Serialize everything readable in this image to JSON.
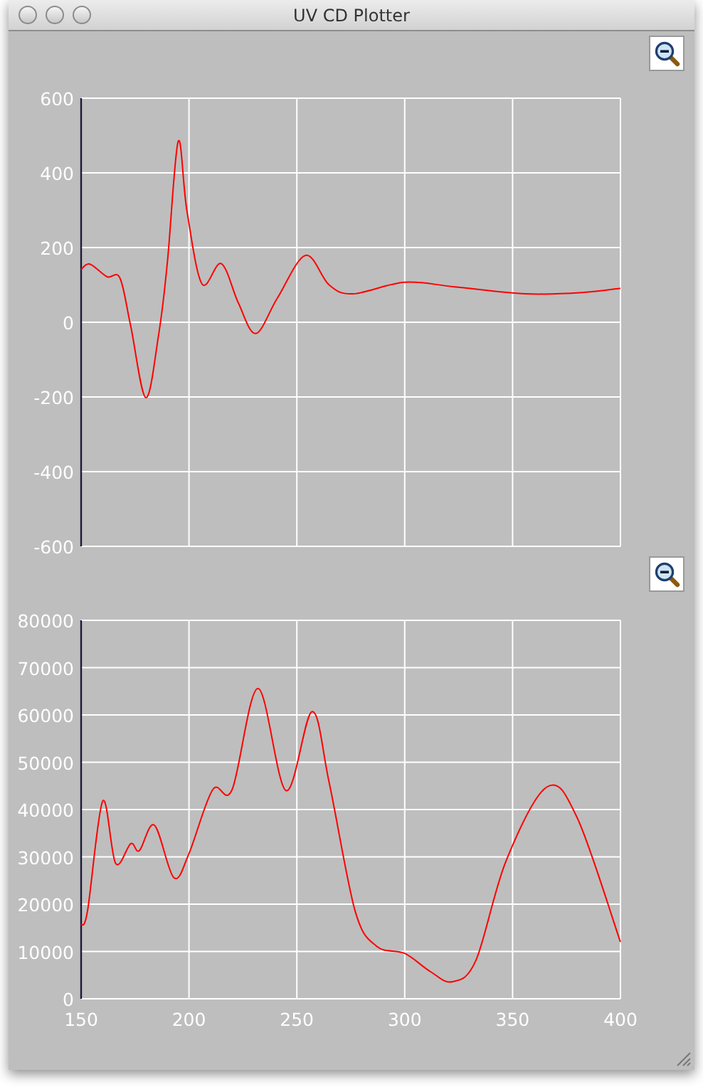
{
  "window": {
    "title": "UV CD Plotter"
  },
  "plots": [
    {
      "zoom_button": {
        "kind": "zoom-out"
      },
      "chart_data": {
        "type": "line",
        "grid": true,
        "xlim": [
          150,
          400
        ],
        "ylim": [
          -600,
          600
        ],
        "yticks": [
          -600,
          -400,
          -200,
          0,
          200,
          400,
          600
        ],
        "x": [
          150,
          154,
          162,
          168,
          173,
          180,
          186,
          190,
          195,
          199,
          206,
          215,
          223,
          231,
          241,
          254,
          265,
          276,
          300,
          323,
          356,
          383,
          400
        ],
        "series": [
          {
            "color": "#ff0000",
            "values": [
              141,
              156,
              122,
              118,
              -11,
              -202,
              -30,
              160,
              484,
              300,
              103,
              157,
              50,
              -30,
              65,
              179,
              100,
              76,
              107,
              95,
              76,
              80,
              91
            ]
          }
        ]
      }
    },
    {
      "zoom_button": {
        "kind": "zoom-out"
      },
      "chart_data": {
        "type": "line",
        "grid": true,
        "xlim": [
          150,
          400
        ],
        "ylim": [
          0,
          80000
        ],
        "xticks": [
          150,
          200,
          250,
          300,
          350,
          400
        ],
        "yticks": [
          0,
          10000,
          20000,
          30000,
          40000,
          50000,
          60000,
          70000,
          80000
        ],
        "x": [
          150,
          153,
          160,
          166,
          173,
          177,
          184,
          193,
          200,
          211,
          220,
          232,
          245,
          257,
          265,
          277,
          287,
          300,
          312,
          322,
          333,
          347,
          366,
          380,
          400
        ],
        "series": [
          {
            "color": "#ff0000",
            "values": [
              15600,
              18600,
              41800,
              28600,
              32800,
              31300,
              36700,
              25600,
              30700,
              44200,
              44200,
              65600,
              44000,
              60700,
              45700,
              18600,
              11100,
              9600,
              5700,
              3600,
              8100,
              29200,
              44800,
              38200,
              12000
            ]
          }
        ]
      }
    }
  ]
}
